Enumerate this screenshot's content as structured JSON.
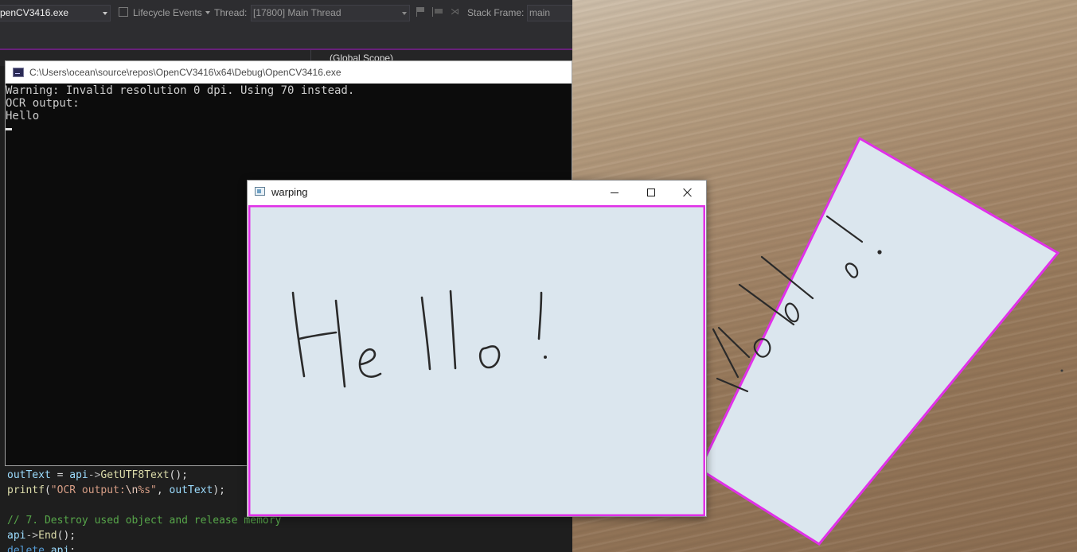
{
  "vs": {
    "toolbar": {
      "process": "penCV3416.exe",
      "lifecycle_label": "Lifecycle Events",
      "thread_label": "Thread:",
      "thread_value": "[17800] Main Thread",
      "stack_frame_label": "Stack Frame:",
      "stack_frame_value": "main"
    },
    "scope_label": "(Global Scope)",
    "code_lines": {
      "l1_var": "outText",
      "l1_mid": " = ",
      "l1_api": "api",
      "l1_arrow": "->",
      "l1_fn": "GetUTF8Text",
      "l1_end": "();",
      "l2_fn": "printf",
      "l2_open": "(",
      "l2_str1": "\"OCR output:",
      "l2_esc": "\\n",
      "l2_str2": "%s\"",
      "l2_sep": ", ",
      "l2_var": "outText",
      "l2_end": ");",
      "l3_comment": "// 7. Destroy used object and release memory",
      "l4_api": "api",
      "l4_arrow": "->",
      "l4_fn": "End",
      "l4_end": "();",
      "l5_kw": "delete",
      "l5_var": "api",
      "l5_end": ";"
    }
  },
  "console": {
    "title": "C:\\Users\\ocean\\source\\repos\\OpenCV3416\\x64\\Debug\\OpenCV3416.exe",
    "lines": [
      "Warning: Invalid resolution 0 dpi. Using 70 instead.",
      "OCR output:",
      "Hello"
    ]
  },
  "warp_window": {
    "title": "warping"
  },
  "colors": {
    "outline": "#e030e8",
    "paper": "#dbe6ee",
    "vs_accent": "#68217a"
  },
  "icons": [
    "console-app-icon",
    "opencv-window-icon",
    "minimize-icon",
    "maximize-icon",
    "close-icon",
    "caret-down-icon",
    "flag-icon"
  ]
}
